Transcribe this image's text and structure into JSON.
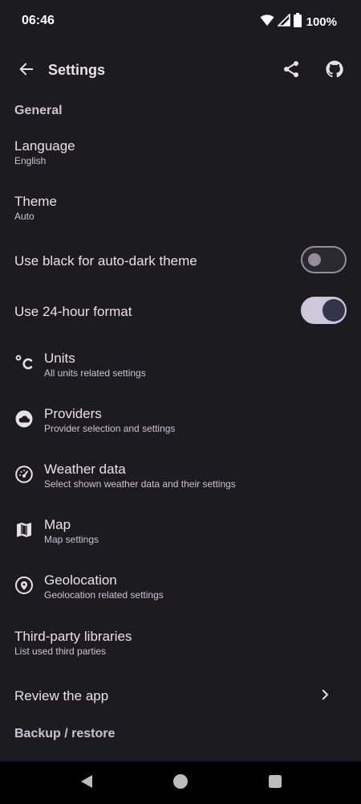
{
  "status_bar": {
    "time": "06:46",
    "battery": "100%",
    "icons": [
      "wifi-icon",
      "signal-icon",
      "battery-icon"
    ]
  },
  "top_bar": {
    "title": "Settings",
    "back_icon": "arrow-back-icon",
    "actions": [
      "share-icon",
      "github-icon"
    ]
  },
  "sections": {
    "general": "General",
    "backup": "Backup / restore"
  },
  "items": {
    "language": {
      "title": "Language",
      "subtitle": "English"
    },
    "theme": {
      "title": "Theme",
      "subtitle": "Auto"
    },
    "black_theme": {
      "title": "Use black for auto-dark theme",
      "checked": false
    },
    "hour_format": {
      "title": "Use 24-hour format",
      "checked": true
    },
    "units": {
      "title": "Units",
      "subtitle": "All units related settings",
      "icon": "celsius-icon"
    },
    "providers": {
      "title": "Providers",
      "subtitle": "Provider selection and settings",
      "icon": "cloud-icon"
    },
    "weather_data": {
      "title": "Weather data",
      "subtitle": "Select shown weather data and their settings",
      "icon": "gauge-icon"
    },
    "map": {
      "title": "Map",
      "subtitle": "Map settings",
      "icon": "map-icon"
    },
    "geolocation": {
      "title": "Geolocation",
      "subtitle": "Geolocation related settings",
      "icon": "location-pin-icon"
    },
    "third_party": {
      "title": "Third-party libraries",
      "subtitle": "List used third parties"
    },
    "review": {
      "title": "Review the app",
      "icon": "chevron-right-icon"
    }
  },
  "colors": {
    "background": "#1c1b1f",
    "text": "#e6e1e5",
    "secondary_text": "#cac4d0",
    "switch_on_track": "#ccc7d9",
    "switch_on_thumb": "#35334a"
  },
  "nav_bar": {
    "buttons": [
      "back-triangle-icon",
      "home-circle-icon",
      "recents-square-icon"
    ]
  }
}
